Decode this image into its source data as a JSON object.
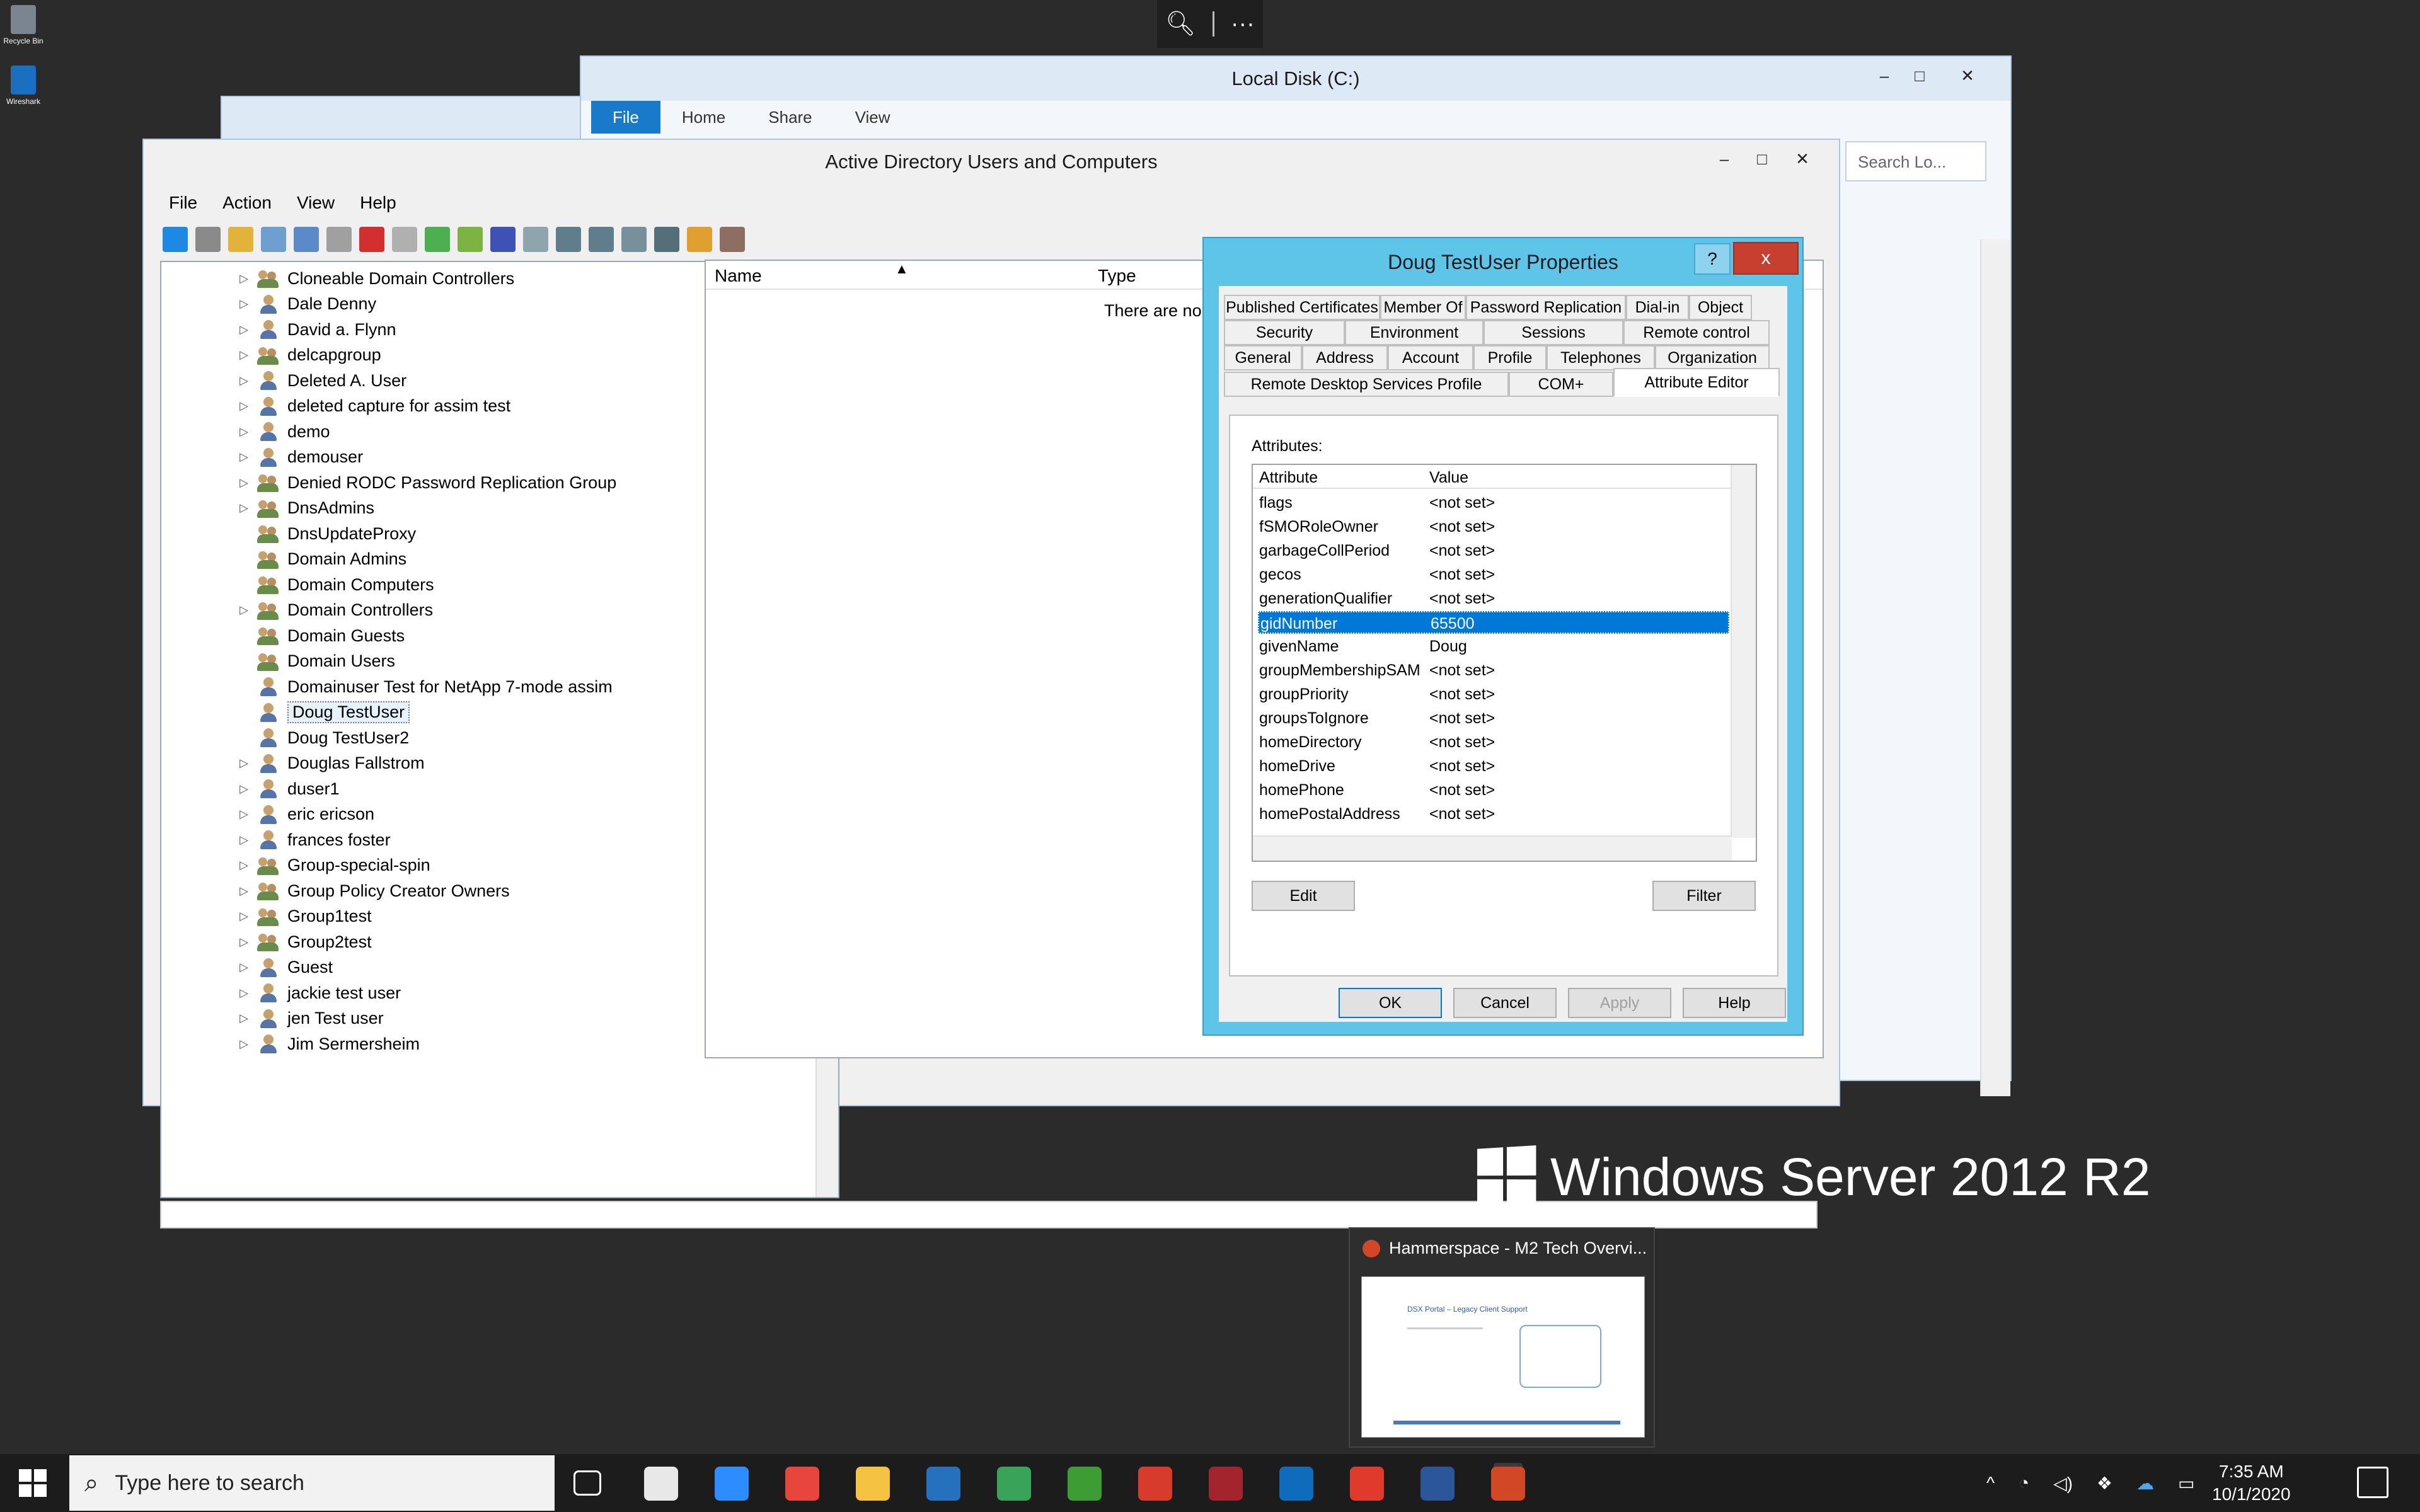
{
  "desktop": {
    "icons": [
      {
        "label": "Recycle Bin",
        "color": "#7a8590"
      },
      {
        "label": "Wireshark",
        "color": "#1a6fc0"
      }
    ]
  },
  "remote_toolbar": {
    "zoom_icon": "zoom-icon",
    "more": "···"
  },
  "explorer": {
    "title": "Local Disk (C:)",
    "tabs": [
      "File",
      "Home",
      "Share",
      "View"
    ],
    "search_placeholder": "Search Lo..."
  },
  "aduc": {
    "title": "Active Directory Users and Computers",
    "menu": [
      "File",
      "Action",
      "View",
      "Help"
    ],
    "tree": [
      {
        "label": "Cloneable Domain Controllers",
        "type": "group",
        "expand": true
      },
      {
        "label": "Dale Denny",
        "type": "user",
        "expand": true
      },
      {
        "label": "David a. Flynn",
        "type": "user",
        "expand": true
      },
      {
        "label": "delcapgroup",
        "type": "group",
        "expand": true
      },
      {
        "label": "Deleted A. User",
        "type": "user",
        "expand": true
      },
      {
        "label": "deleted capture for assim test",
        "type": "user",
        "expand": true
      },
      {
        "label": "demo",
        "type": "user",
        "expand": true
      },
      {
        "label": "demouser",
        "type": "user",
        "expand": true
      },
      {
        "label": "Denied RODC Password Replication Group",
        "type": "group",
        "expand": true
      },
      {
        "label": "DnsAdmins",
        "type": "group",
        "expand": true
      },
      {
        "label": "DnsUpdateProxy",
        "type": "group",
        "expand": false
      },
      {
        "label": "Domain Admins",
        "type": "group",
        "expand": false
      },
      {
        "label": "Domain Computers",
        "type": "group",
        "expand": false
      },
      {
        "label": "Domain Controllers",
        "type": "group",
        "expand": true
      },
      {
        "label": "Domain Guests",
        "type": "group",
        "expand": false
      },
      {
        "label": "Domain Users",
        "type": "group",
        "expand": false
      },
      {
        "label": "Domainuser Test for NetApp 7-mode assim",
        "type": "user",
        "expand": false
      },
      {
        "label": "Doug TestUser",
        "type": "user",
        "expand": false,
        "selected": true
      },
      {
        "label": "Doug TestUser2",
        "type": "user",
        "expand": false
      },
      {
        "label": "Douglas Fallstrom",
        "type": "user",
        "expand": true
      },
      {
        "label": "duser1",
        "type": "user",
        "expand": true
      },
      {
        "label": "eric ericson",
        "type": "user",
        "expand": true
      },
      {
        "label": "frances foster",
        "type": "user",
        "expand": true
      },
      {
        "label": "Group-special-spin",
        "type": "group",
        "expand": true
      },
      {
        "label": "Group Policy Creator Owners",
        "type": "group",
        "expand": true
      },
      {
        "label": "Group1test",
        "type": "group",
        "expand": true
      },
      {
        "label": "Group2test",
        "type": "group",
        "expand": true
      },
      {
        "label": "Guest",
        "type": "user",
        "expand": true
      },
      {
        "label": "jackie test user",
        "type": "user",
        "expand": true
      },
      {
        "label": "jen Test user",
        "type": "user",
        "expand": true
      },
      {
        "label": "Jim Sermersheim",
        "type": "user",
        "expand": true
      }
    ],
    "list": {
      "col_name": "Name",
      "col_type": "Type",
      "empty_text": "There are no"
    }
  },
  "properties": {
    "title": "Doug TestUser Properties",
    "help_btn": "?",
    "close_btn": "x",
    "tabs_row1": [
      "Published Certificates",
      "Member Of",
      "Password Replication",
      "Dial-in",
      "Object"
    ],
    "tabs_row2": [
      "Security",
      "Environment",
      "Sessions",
      "Remote control"
    ],
    "tabs_row3": [
      "General",
      "Address",
      "Account",
      "Profile",
      "Telephones",
      "Organization"
    ],
    "tabs_row4": [
      "Remote Desktop Services Profile",
      "COM+",
      "Attribute Editor"
    ],
    "attributes_label": "Attributes:",
    "col_attribute": "Attribute",
    "col_value": "Value",
    "attributes": [
      {
        "name": "flags",
        "value": "<not set>"
      },
      {
        "name": "fSMORoleOwner",
        "value": "<not set>"
      },
      {
        "name": "garbageCollPeriod",
        "value": "<not set>"
      },
      {
        "name": "gecos",
        "value": "<not set>"
      },
      {
        "name": "generationQualifier",
        "value": "<not set>"
      },
      {
        "name": "gidNumber",
        "value": "65500",
        "selected": true
      },
      {
        "name": "givenName",
        "value": "Doug"
      },
      {
        "name": "groupMembershipSAM",
        "value": "<not set>"
      },
      {
        "name": "groupPriority",
        "value": "<not set>"
      },
      {
        "name": "groupsToIgnore",
        "value": "<not set>"
      },
      {
        "name": "homeDirectory",
        "value": "<not set>"
      },
      {
        "name": "homeDrive",
        "value": "<not set>"
      },
      {
        "name": "homePhone",
        "value": "<not set>"
      },
      {
        "name": "homePostalAddress",
        "value": "<not set>"
      }
    ],
    "edit_btn": "Edit",
    "filter_btn": "Filter",
    "ok_btn": "OK",
    "cancel_btn": "Cancel",
    "apply_btn": "Apply",
    "help_button": "Help"
  },
  "branding": "Windows Server 2012 R2",
  "thumbnail": {
    "title": "Hammerspace - M2 Tech Overvi...",
    "slide_title": "DSX Portal – Legacy Client Support"
  },
  "taskbar": {
    "search_placeholder": "Type here to search",
    "apps": [
      {
        "name": "task-view-icon",
        "color": "#1c1c1c"
      },
      {
        "name": "slack-icon",
        "color": "#e8e8e8"
      },
      {
        "name": "zoom-app-icon",
        "color": "#2d8cff"
      },
      {
        "name": "chrome-icon",
        "color": "#e8453c"
      },
      {
        "name": "file-explorer-icon",
        "color": "#f5c242"
      },
      {
        "name": "powershell-icon",
        "color": "#2671be"
      },
      {
        "name": "green-app-icon",
        "color": "#3aa35a"
      },
      {
        "name": "y-app-icon",
        "color": "#3e9c35"
      },
      {
        "name": "remote-desktop-icon",
        "color": "#d63b2b"
      },
      {
        "name": "red-app-icon",
        "color": "#a3242c"
      },
      {
        "name": "outlook-icon",
        "color": "#0f6cbd"
      },
      {
        "name": "x-app-icon",
        "color": "#e03a2c"
      },
      {
        "name": "word-icon",
        "color": "#2b579a"
      },
      {
        "name": "powerpoint-icon",
        "color": "#d24726"
      }
    ],
    "time": "7:35 AM",
    "date": "10/1/2020"
  }
}
